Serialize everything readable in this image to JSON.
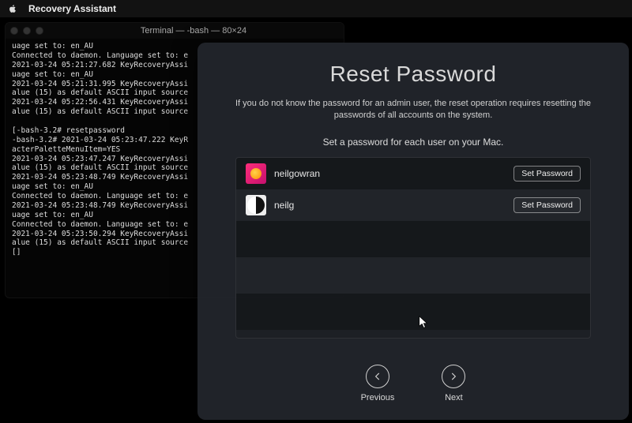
{
  "menubar": {
    "app_name": "Recovery Assistant"
  },
  "terminal": {
    "title": "Terminal — -bash — 80×24",
    "body": "uage set to: en_AU\nConnected to daemon. Language set to: e\n2021-03-24 05:21:27.682 KeyRecoveryAssi\nuage set to: en_AU\n2021-03-24 05:21:31.995 KeyRecoveryAssi\nalue (15) as default ASCII input source\n2021-03-24 05:22:56.431 KeyRecoveryAssi\nalue (15) as default ASCII input source\n\n[-bash-3.2# resetpassword\n-bash-3.2# 2021-03-24 05:23:47.222 KeyR\nacterPaletteMenuItem=YES\n2021-03-24 05:23:47.247 KeyRecoveryAssi\nalue (15) as default ASCII input source\n2021-03-24 05:23:48.749 KeyRecoveryAssi\nuage set to: en_AU\nConnected to daemon. Language set to: e\n2021-03-24 05:23:48.749 KeyRecoveryAssi\nuage set to: en_AU\nConnected to daemon. Language set to: e\n2021-03-24 05:23:50.294 KeyRecoveryAssi\nalue (15) as default ASCII input source\n[]"
  },
  "panel": {
    "title": "Reset Password",
    "description": "If you do not know the password for an admin user, the reset operation requires resetting the passwords of all accounts on the system.",
    "subheading": "Set a password for each user on your Mac.",
    "set_password_label": "Set Password",
    "users": [
      {
        "name": "neilgowran",
        "avatar": "pink"
      },
      {
        "name": "neilg",
        "avatar": "yinyang"
      }
    ],
    "nav": {
      "previous": "Previous",
      "next": "Next"
    }
  }
}
